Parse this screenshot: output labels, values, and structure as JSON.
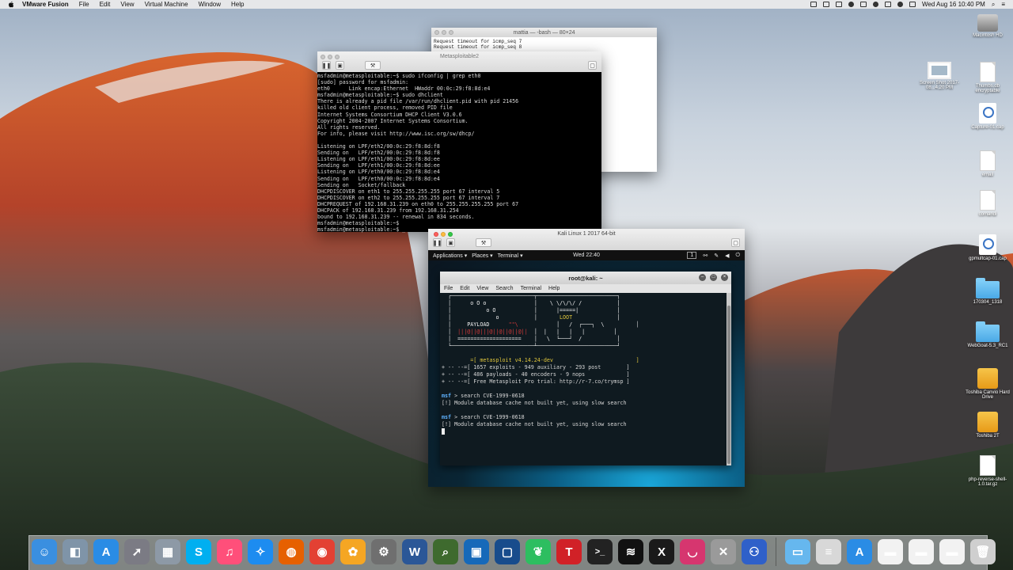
{
  "menubar": {
    "app_name": "VMware Fusion",
    "menus": [
      "File",
      "Edit",
      "View",
      "Virtual Machine",
      "Window",
      "Help"
    ],
    "datetime": "Wed Aug 16  10:40 PM"
  },
  "bash_window": {
    "title": "mattia — -bash — 80×24",
    "lines": [
      "Request timeout for icmp_seq 7",
      "Request timeout for icmp_seq 8"
    ]
  },
  "metasploitable_window": {
    "title": "Metasploitable2",
    "console": [
      "msfadmin@metasploitable:~$ sudo ifconfig | grep eth0",
      "[sudo] password for msfadmin:",
      "eth0      Link encap:Ethernet  HWaddr 00:0c:29:f8:8d:e4",
      "msfadmin@metasploitable:~$ sudo dhclient",
      "There is already a pid file /var/run/dhclient.pid with pid 21456",
      "killed old client process, removed PID file",
      "Internet Systems Consortium DHCP Client V3.0.6",
      "Copyright 2004-2007 Internet Systems Consortium.",
      "All rights reserved.",
      "For info, please visit http://www.isc.org/sw/dhcp/",
      "",
      "Listening on LPF/eth2/00:0c:29:f8:8d:f8",
      "Sending on   LPF/eth2/00:0c:29:f8:8d:f8",
      "Listening on LPF/eth1/00:0c:29:f8:8d:ee",
      "Sending on   LPF/eth1/00:0c:29:f8:8d:ee",
      "Listening on LPF/eth0/00:0c:29:f8:8d:e4",
      "Sending on   LPF/eth0/00:0c:29:f8:8d:e4",
      "Sending on   Socket/fallback",
      "DHCPDISCOVER on eth1 to 255.255.255.255 port 67 interval 5",
      "DHCPDISCOVER on eth2 to 255.255.255.255 port 67 interval 7",
      "DHCPREQUEST of 192.168.31.239 on eth0 to 255.255.255.255 port 67",
      "DHCPACK of 192.168.31.239 from 192.168.31.254",
      "bound to 192.168.31.239 -- renewal in 834 seconds.",
      "msfadmin@metasploitable:~$",
      "msfadmin@metasploitable:~$ _"
    ]
  },
  "kali_window": {
    "title": "Kali Linux 1 2017 64-bit",
    "panel": {
      "applications": "Applications ▾",
      "places": "Places ▾",
      "terminal": "Terminal ▾",
      "clock": "Wed 22:40",
      "workspace": "1"
    },
    "terminal": {
      "title": "root@kali: ~",
      "menu": [
        "File",
        "Edit",
        "View",
        "Search",
        "Terminal",
        "Help"
      ],
      "banner_payload": "PAYLOAD",
      "banner_loot": "LOOT",
      "version_line": "=[ metasploit v4.14.24-dev                          ]",
      "stats": [
        "+ -- --=[ 1657 exploits - 949 auxiliary - 293 post        ]",
        "+ -- --=[ 486 payloads - 40 encoders - 9 nops             ]",
        "+ -- --=[ Free Metasploit Pro trial: http://r-7.co/trymsp ]"
      ],
      "prompt": "msf",
      "commands": [
        {
          "cmd": " > search CVE-1999-0618",
          "msg": "[!] Module database cache not built yet, using slow search"
        },
        {
          "cmd": " > search CVE-1999-0618",
          "msg": "[!] Module database cache not built yet, using slow search"
        }
      ]
    }
  },
  "desktop_icons": [
    {
      "label": "Macintosh HD",
      "kind": "hdd"
    },
    {
      "label": "Screen Shot 2017-08...4.20 PM",
      "kind": "shot"
    },
    {
      "label": "Thumbs.db encryptable",
      "kind": "doc"
    },
    {
      "label": "Capture-01.cap",
      "kind": "cap"
    },
    {
      "label": "email",
      "kind": "doc"
    },
    {
      "label": "comandi",
      "kind": "doc"
    },
    {
      "label": "gpmultcap-01.cap",
      "kind": "cap"
    },
    {
      "label": "170304_1318",
      "kind": "folder"
    },
    {
      "label": "WebGoat-5.3_RC1",
      "kind": "folder"
    },
    {
      "label": "Toshiba Canvio Hard Drive",
      "kind": "drive"
    },
    {
      "label": "Toshiba 2T",
      "kind": "drive"
    },
    {
      "label": "php-reverse-shell-1.0.tar.gz",
      "kind": "doc"
    }
  ],
  "dock": {
    "apps": [
      {
        "name": "finder-icon",
        "glyph": "☺",
        "color": "#3a8fe0"
      },
      {
        "name": "preview-icon",
        "glyph": "◧",
        "color": "#7f94a8"
      },
      {
        "name": "app-store-icon",
        "glyph": "A",
        "color": "#2a8ce5"
      },
      {
        "name": "launchpad-icon",
        "glyph": "➚",
        "color": "#7b7b84"
      },
      {
        "name": "image-capture-icon",
        "glyph": "▦",
        "color": "#8d99a6"
      },
      {
        "name": "skype-icon",
        "glyph": "S",
        "color": "#00aff0"
      },
      {
        "name": "itunes-icon",
        "glyph": "♫",
        "color": "#ff4f7a"
      },
      {
        "name": "safari-icon",
        "glyph": "✧",
        "color": "#1d8cf0"
      },
      {
        "name": "firefox-icon",
        "glyph": "◍",
        "color": "#e66000"
      },
      {
        "name": "chrome-icon",
        "glyph": "◉",
        "color": "#e34133"
      },
      {
        "name": "photos-icon",
        "glyph": "✿",
        "color": "#f5a623"
      },
      {
        "name": "disk-utility-icon",
        "glyph": "⚙",
        "color": "#6f6f6f"
      },
      {
        "name": "word-icon",
        "glyph": "W",
        "color": "#2b5797"
      },
      {
        "name": "wireshark-magnifier-icon",
        "glyph": "⌕",
        "color": "#3e6a2e"
      },
      {
        "name": "vmware-icon",
        "glyph": "▣",
        "color": "#1669b9"
      },
      {
        "name": "virtualbox-icon",
        "glyph": "▢",
        "color": "#184c8c"
      },
      {
        "name": "evernote-icon",
        "glyph": "❦",
        "color": "#2dbe60"
      },
      {
        "name": "t-app-icon",
        "glyph": "T",
        "color": "#d12127"
      },
      {
        "name": "terminal-icon",
        "glyph": ">_",
        "color": "#222222"
      },
      {
        "name": "activity-monitor-icon",
        "glyph": "≋",
        "color": "#111111"
      },
      {
        "name": "x11-icon",
        "glyph": "X",
        "color": "#1a1a1a"
      },
      {
        "name": "lips-app-icon",
        "glyph": "◡",
        "color": "#d6366f"
      },
      {
        "name": "grapher-icon",
        "glyph": "✕",
        "color": "#9a9a9a"
      },
      {
        "name": "remote-desktop-icon",
        "glyph": "⚇",
        "color": "#2f60c9"
      }
    ],
    "right": [
      {
        "name": "applications-folder-icon",
        "glyph": "▭",
        "color": "#66b7ee"
      },
      {
        "name": "documents-icon",
        "glyph": "≡",
        "color": "#d8d8d8"
      },
      {
        "name": "downloads-app-store-icon",
        "glyph": "A",
        "color": "#2a8ce5"
      },
      {
        "name": "screen-thumb-icon",
        "glyph": "▬",
        "color": "#f2f2f2"
      },
      {
        "name": "screen-thumb-2-icon",
        "glyph": "▬",
        "color": "#f2f2f2"
      },
      {
        "name": "screen-thumb-3-icon",
        "glyph": "▬",
        "color": "#f2f2f2"
      },
      {
        "name": "trash-icon",
        "glyph": "🗑",
        "color": "#cfcfcf"
      }
    ]
  }
}
